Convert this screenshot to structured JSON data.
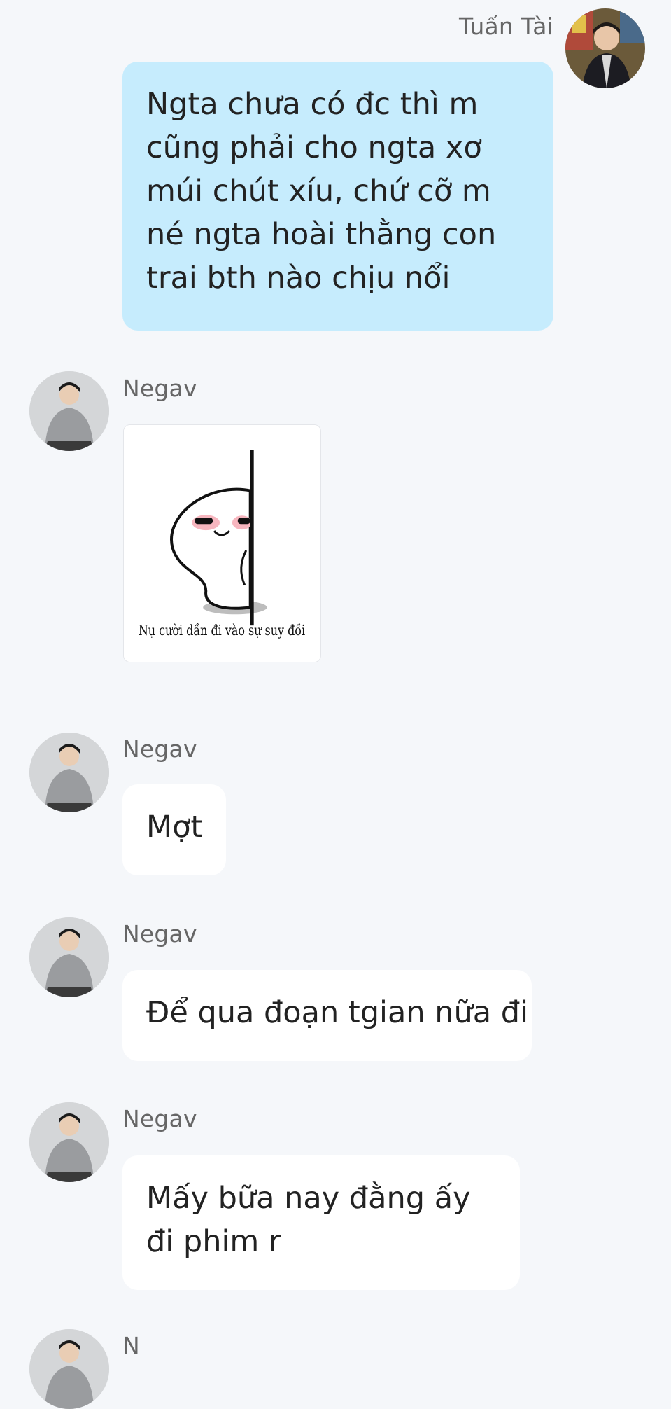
{
  "chat": {
    "messages": [
      {
        "sender": "Tuấn Tài",
        "side": "right",
        "text": "Ngta chưa có đc thì m cũng phải cho ngta xơ múi chút xíu, chứ cỡ m né ngta hoài thằng con trai bth nào chịu nổi"
      },
      {
        "sender": "Negav",
        "side": "left",
        "sticker": {
          "caption": "Nụ cười dần đi vào sự suy đồi",
          "icon": "peeking-blushing-sticker"
        }
      },
      {
        "sender": "Negav",
        "side": "left",
        "text": "Mợt"
      },
      {
        "sender": "Negav",
        "side": "left",
        "text": "Để qua đoạn tgian nữa đi"
      },
      {
        "sender": "Negav",
        "side": "left",
        "text": "Mấy bữa nay đằng ấy đi phim r"
      },
      {
        "sender": "N",
        "side": "left",
        "partial": true
      }
    ]
  },
  "colors": {
    "background": "#f5f7fa",
    "bubble_mine": "#c6ecfd",
    "bubble_theirs": "#ffffff",
    "name_text": "#666666"
  }
}
